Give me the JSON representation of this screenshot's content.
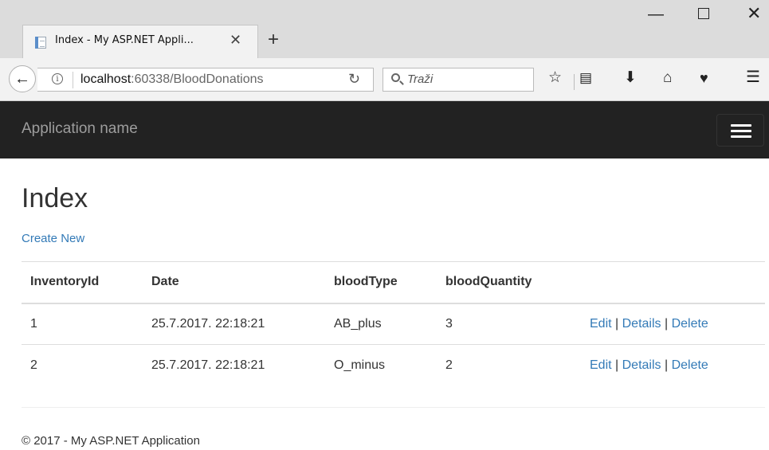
{
  "browser": {
    "tab_title": "Index - My ASP.NET Appli...",
    "url_host": "localhost",
    "url_path": ":60338/BloodDonations",
    "search_placeholder": "Traži"
  },
  "app": {
    "brand": "Application name"
  },
  "page": {
    "title": "Index",
    "create_link": "Create New"
  },
  "table": {
    "headers": [
      "InventoryId",
      "Date",
      "bloodType",
      "bloodQuantity"
    ],
    "rows": [
      {
        "id": "1",
        "date": "25.7.2017. 22:18:21",
        "type": "AB_plus",
        "qty": "3"
      },
      {
        "id": "2",
        "date": "25.7.2017. 22:18:21",
        "type": "O_minus",
        "qty": "2"
      }
    ],
    "actions": {
      "edit": "Edit",
      "details": "Details",
      "delete": "Delete",
      "sep": " | "
    }
  },
  "footer": "© 2017 - My ASP.NET Application"
}
